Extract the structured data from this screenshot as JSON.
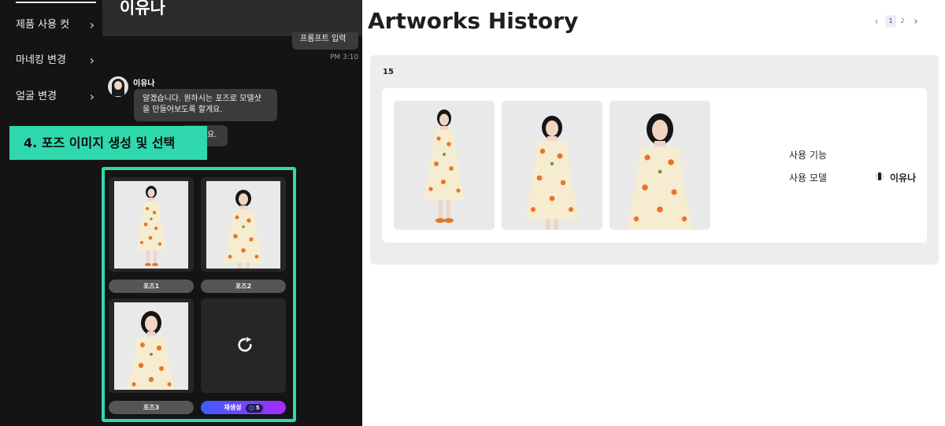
{
  "sidebar": {
    "items": [
      {
        "label": "제품 사용 컷"
      },
      {
        "label": "마네킹 변경"
      },
      {
        "label": "얼굴 변경"
      }
    ]
  },
  "chat": {
    "header_name": "이유나",
    "user_message": "프롬프트 입력",
    "user_time": "PM 3:10",
    "bot_name": "이유나",
    "bot_message_line1": "알겠습니다. 원하시는 포즈로 모델샷",
    "bot_message_line2": "을 만들어보도록 할게요.",
    "bot_message2": "요."
  },
  "step_label": "4. 포즈 이미지 생성  및 선택",
  "poses": [
    {
      "label": "포즈1"
    },
    {
      "label": "포즈2"
    },
    {
      "label": "포즈3"
    }
  ],
  "regenerate": {
    "label": "재생성",
    "cost": "5"
  },
  "history": {
    "title": "Artworks History",
    "count": "15",
    "pages": [
      "1",
      "2"
    ],
    "meta": {
      "feature_label": "사용 기능",
      "feature_value": "",
      "model_label": "사용 모델",
      "model_value": "이유나"
    }
  },
  "colors": {
    "accent": "#2fd8ad",
    "dark_bg": "#141414",
    "regen_gradient_start": "#3f5cff",
    "regen_gradient_end": "#a52bff"
  },
  "icons": [
    "chevron-right-icon",
    "refresh-icon",
    "coin-icon",
    "chevron-left-icon",
    "avatar-icon"
  ]
}
